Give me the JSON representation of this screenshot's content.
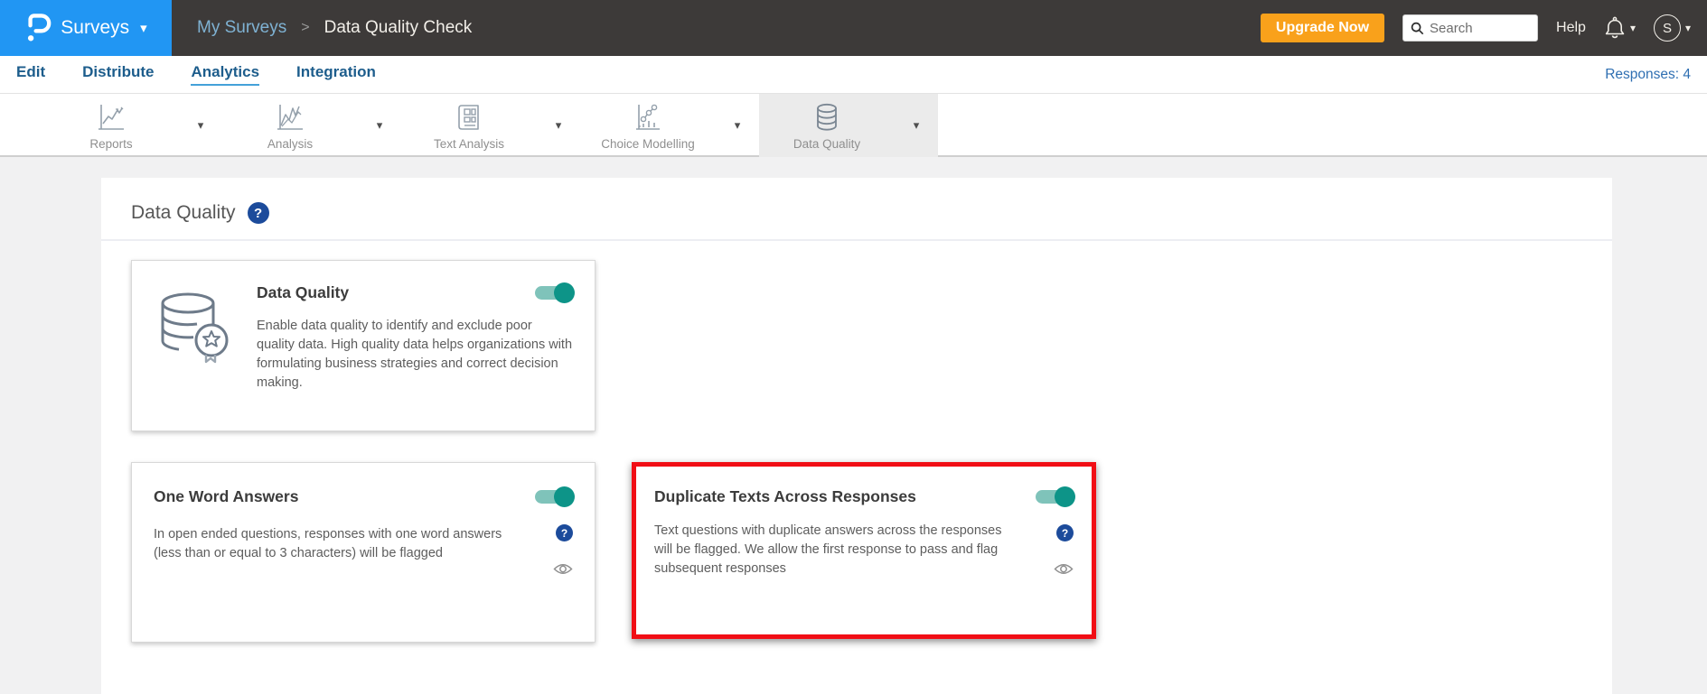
{
  "header": {
    "product": "Surveys",
    "breadcrumb": {
      "parent": "My Surveys",
      "separator": ">",
      "current": "Data Quality Check"
    },
    "upgrade_button": "Upgrade Now",
    "search_placeholder": "Search",
    "help_link": "Help",
    "avatar_initial": "S"
  },
  "subnav": {
    "items": [
      {
        "label": "Edit",
        "active": false
      },
      {
        "label": "Distribute",
        "active": false
      },
      {
        "label": "Analytics",
        "active": true
      },
      {
        "label": "Integration",
        "active": false
      }
    ],
    "responses_badge": "Responses: 4"
  },
  "tabs": [
    {
      "label": "Reports",
      "icon": "line-chart-icon",
      "active": false
    },
    {
      "label": "Analysis",
      "icon": "multi-line-chart-icon",
      "active": false
    },
    {
      "label": "Text Analysis",
      "icon": "newspaper-icon",
      "active": false
    },
    {
      "label": "Choice Modelling",
      "icon": "scatter-chart-icon",
      "active": false
    },
    {
      "label": "Data Quality",
      "icon": "database-icon",
      "active": true
    }
  ],
  "main": {
    "title": "Data Quality",
    "cards": [
      {
        "title": "Data Quality",
        "description": "Enable data quality to identify and exclude poor quality data. High quality data helps organizations with formulating business strategies and correct decision making.",
        "toggle": "on",
        "icon": "database-badge-icon"
      },
      {
        "title": "One Word Answers",
        "description": "In open ended questions, responses with one word answers (less than or equal to 3 characters) will be flagged",
        "toggle": "on"
      },
      {
        "title": "Duplicate Texts Across Responses",
        "description": "Text questions with duplicate answers across the responses will be flagged. We allow the first response to pass and flag subsequent responses",
        "toggle": "on",
        "highlighted": true
      }
    ]
  },
  "glyphs": {
    "caret_down": "▾",
    "question_mark": "?"
  },
  "colors": {
    "header_bg": "#3d3a39",
    "accent_blue": "#2196f3",
    "orange": "#f9a11b",
    "link_blue": "#1d5d8c",
    "toggle_teal": "#0d9488",
    "highlight_red": "#f10e15"
  }
}
